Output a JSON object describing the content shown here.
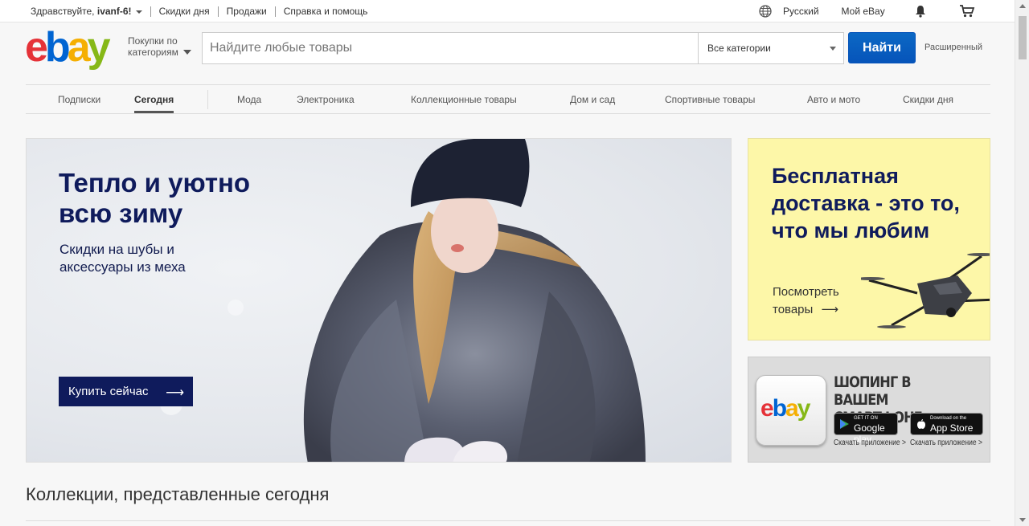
{
  "topbar": {
    "greeting_prefix": "Здравствуйте,",
    "username": "ivanf-6!",
    "links": [
      "Скидки дня",
      "Продажи",
      "Справка и помощь"
    ],
    "language": "Русский",
    "my_ebay": "Мой eBay"
  },
  "header": {
    "logo": {
      "e": "e",
      "b": "b",
      "a": "a",
      "y": "y"
    },
    "shop_by_line1": "Покупки по",
    "shop_by_line2": "категориям",
    "search_placeholder": "Найдите любые товары",
    "category_select": "Все категории",
    "search_button": "Найти",
    "advanced": "Расширенный"
  },
  "nav": {
    "items": [
      "Подписки",
      "Сегодня",
      "Мода",
      "Электроника",
      "Коллекционные товары",
      "Дом и сад",
      "Спортивные товары",
      "Авто и мото",
      "Скидки дня"
    ],
    "active": "Сегодня"
  },
  "hero": {
    "title": "Тепло и уютно всю зиму",
    "subtitle": "Скидки на шубы и аксессуары из меха",
    "cta": "Купить сейчас"
  },
  "promo": {
    "title": "Бесплатная доставка - это то, что мы любим",
    "link": "Посмотреть товары"
  },
  "app_card": {
    "title": "ШОПИНГ В ВАШЕМ СМАРТФОНЕ",
    "google_small": "GET IT ON",
    "google_big": "Google play",
    "apple_small": "Download on the",
    "apple_big": "App Store",
    "caption": "Скачать приложение >"
  },
  "section": {
    "title": "Коллекции, представленные сегодня"
  },
  "colors": {
    "brand_blue": "#0654ba",
    "navy": "#0f1b5c",
    "promo_yellow": "#fdf7a8"
  }
}
